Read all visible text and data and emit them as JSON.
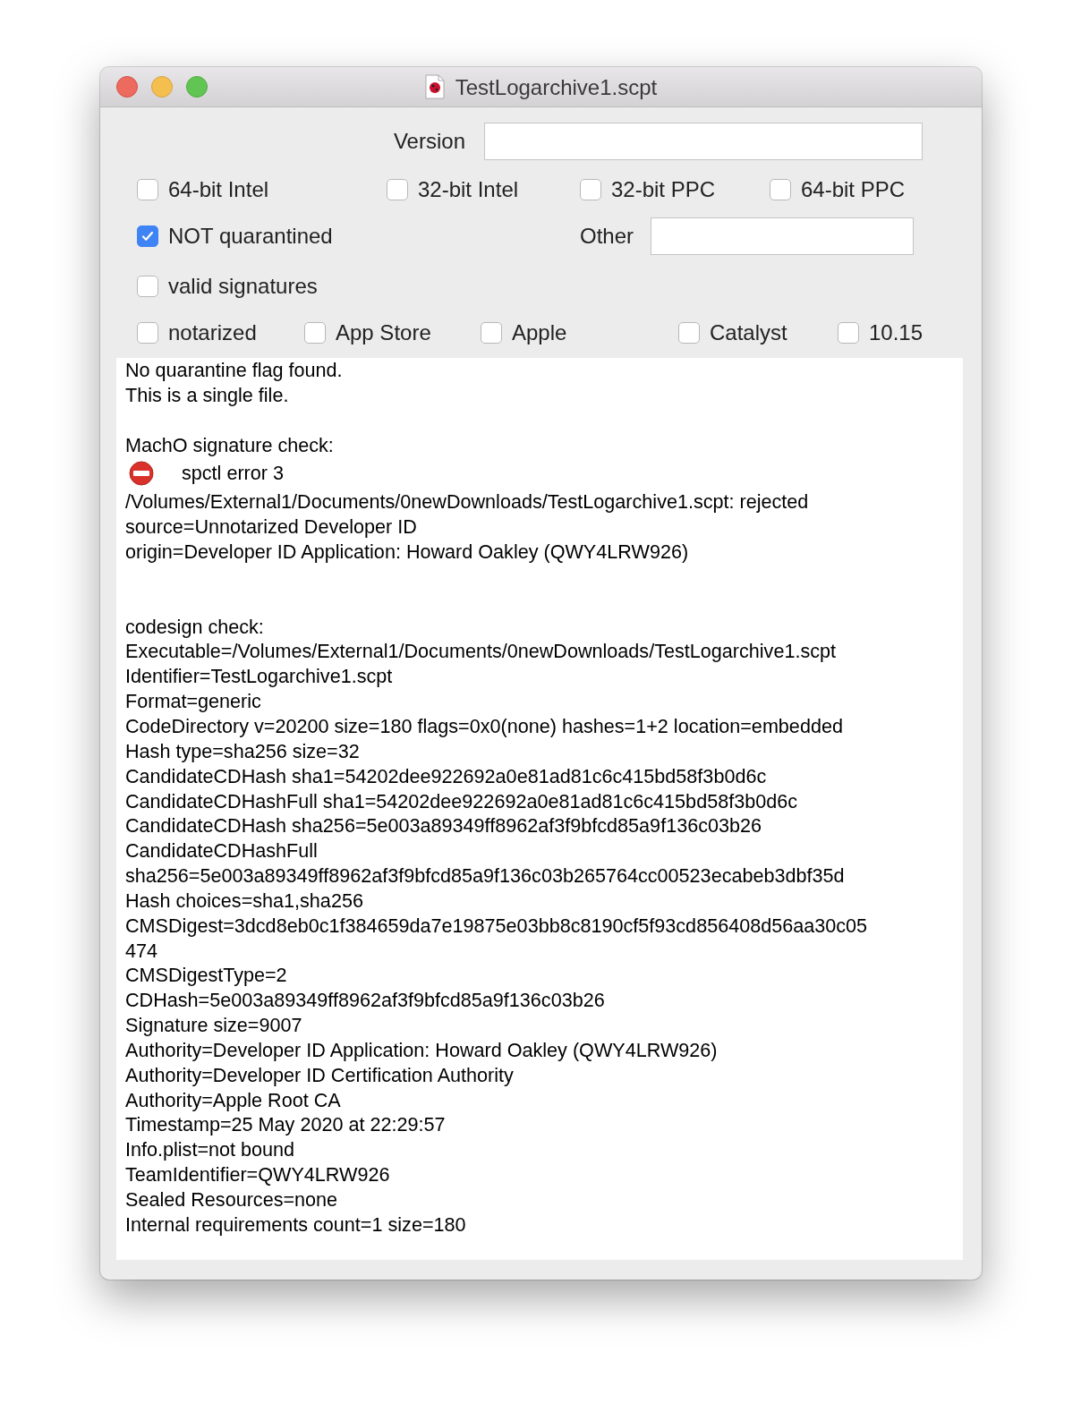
{
  "window": {
    "title": "TestLogarchive1.scpt"
  },
  "version_field": {
    "label": "Version"
  },
  "architectures": [
    {
      "label": "64-bit Intel",
      "checked": false
    },
    {
      "label": "32-bit Intel",
      "checked": false
    },
    {
      "label": "32-bit PPC",
      "checked": false
    },
    {
      "label": "64-bit PPC",
      "checked": false
    }
  ],
  "quarantine": {
    "label": "NOT quarantined",
    "checked": true
  },
  "other_field": {
    "label": "Other"
  },
  "signatures": {
    "label": "valid signatures",
    "checked": false
  },
  "flags": [
    {
      "label": "notarized",
      "checked": false
    },
    {
      "label": "App Store",
      "checked": false
    },
    {
      "label": "Apple",
      "checked": false
    },
    {
      "label": "Catalyst",
      "checked": false
    },
    {
      "label": "10.15",
      "checked": false
    }
  ],
  "output": [
    {
      "kind": "text",
      "text": "No quarantine flag found."
    },
    {
      "kind": "text",
      "text": "This is a single file."
    },
    {
      "kind": "blank"
    },
    {
      "kind": "text",
      "text": "MachO signature check:"
    },
    {
      "kind": "error",
      "text": "spctl error 3"
    },
    {
      "kind": "text",
      "text": "/Volumes/External1/Documents/0newDownloads/TestLogarchive1.scpt: rejected"
    },
    {
      "kind": "text",
      "text": "source=Unnotarized Developer ID"
    },
    {
      "kind": "text",
      "text": "origin=Developer ID Application: Howard Oakley (QWY4LRW926)"
    },
    {
      "kind": "blank"
    },
    {
      "kind": "blank"
    },
    {
      "kind": "text",
      "text": "codesign check:"
    },
    {
      "kind": "text",
      "text": "Executable=/Volumes/External1/Documents/0newDownloads/TestLogarchive1.scpt"
    },
    {
      "kind": "text",
      "text": "Identifier=TestLogarchive1.scpt"
    },
    {
      "kind": "text",
      "text": "Format=generic"
    },
    {
      "kind": "text",
      "text": "CodeDirectory v=20200 size=180 flags=0x0(none) hashes=1+2 location=embedded"
    },
    {
      "kind": "text",
      "text": "Hash type=sha256 size=32"
    },
    {
      "kind": "text",
      "text": "CandidateCDHash sha1=54202dee922692a0e81ad81c6c415bd58f3b0d6c"
    },
    {
      "kind": "text",
      "text": "CandidateCDHashFull sha1=54202dee922692a0e81ad81c6c415bd58f3b0d6c"
    },
    {
      "kind": "text",
      "text": "CandidateCDHash sha256=5e003a89349ff8962af3f9bfcd85a9f136c03b26"
    },
    {
      "kind": "text",
      "text": "CandidateCDHashFull"
    },
    {
      "kind": "text",
      "text": "sha256=5e003a89349ff8962af3f9bfcd85a9f136c03b265764cc00523ecabeb3dbf35d"
    },
    {
      "kind": "text",
      "text": "Hash choices=sha1,sha256"
    },
    {
      "kind": "text",
      "text": "CMSDigest=3dcd8eb0c1f384659da7e19875e03bb8c8190cf5f93cd856408d56aa30c05"
    },
    {
      "kind": "text",
      "text": "474"
    },
    {
      "kind": "text",
      "text": "CMSDigestType=2"
    },
    {
      "kind": "text",
      "text": "CDHash=5e003a89349ff8962af3f9bfcd85a9f136c03b26"
    },
    {
      "kind": "text",
      "text": "Signature size=9007"
    },
    {
      "kind": "text",
      "text": "Authority=Developer ID Application: Howard Oakley (QWY4LRW926)"
    },
    {
      "kind": "text",
      "text": "Authority=Developer ID Certification Authority"
    },
    {
      "kind": "text",
      "text": "Authority=Apple Root CA"
    },
    {
      "kind": "text",
      "text": "Timestamp=25 May 2020 at 22:29:57"
    },
    {
      "kind": "text",
      "text": "Info.plist=not bound"
    },
    {
      "kind": "text",
      "text": "TeamIdentifier=QWY4LRW926"
    },
    {
      "kind": "text",
      "text": "Sealed Resources=none"
    },
    {
      "kind": "text",
      "text": "Internal requirements count=1 size=180"
    }
  ]
}
